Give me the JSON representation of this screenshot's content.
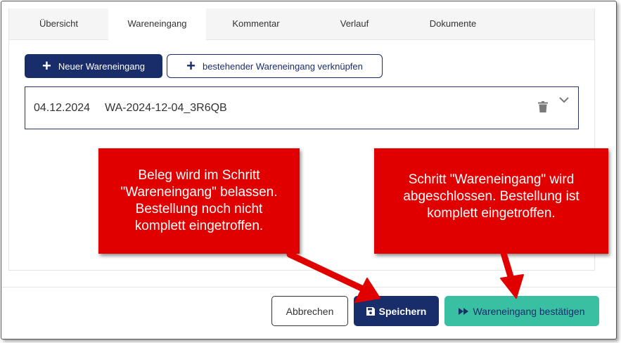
{
  "tabs": [
    {
      "label": "Übersicht",
      "active": false
    },
    {
      "label": "Wareneingang",
      "active": true
    },
    {
      "label": "Kommentar",
      "active": false
    },
    {
      "label": "Verlauf",
      "active": false
    },
    {
      "label": "Dokumente",
      "active": false
    }
  ],
  "actions": {
    "new_label": "Neuer Wareneingang",
    "link_label": "bestehender Wareneingang verknüpfen"
  },
  "entry": {
    "date": "04.12.2024",
    "number": "WA-2024-12-04_3R6QB"
  },
  "footer": {
    "cancel_label": "Abbrechen",
    "save_label": "Speichern",
    "confirm_label": "Wareneingang bestätigen"
  },
  "callouts": {
    "left": [
      "Beleg wird im Schritt",
      "\"Wareneingang\" belassen.",
      "Bestellung noch nicht",
      "komplett eingetroffen."
    ],
    "right": [
      "Schritt \"Wareneingang\" wird",
      "abgeschlossen. Bestellung ist",
      "komplett eingetroffen."
    ]
  },
  "colors": {
    "primary": "#1a2d6b",
    "confirm": "#39c0a3",
    "callout": "#e00000"
  }
}
